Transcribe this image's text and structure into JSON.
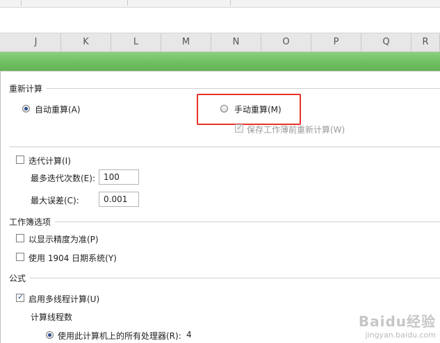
{
  "column_headers": [
    "J",
    "K",
    "L",
    "M",
    "N",
    "O",
    "P",
    "Q",
    "R"
  ],
  "recalc": {
    "title": "重新计算",
    "automatic_label": "自动重算(A)",
    "manual_label": "手动重算(M)",
    "save_before_recalc_label": "保存工作薄前重新计算(W)",
    "automatic_checked": true,
    "manual_checked": false
  },
  "iteration": {
    "enable_label": "迭代计算(I)",
    "max_iterations_label": "最多迭代次数(E):",
    "max_iterations_value": "100",
    "max_change_label": "最大误差(C):",
    "max_change_value": "0.001"
  },
  "workbook_options": {
    "title": "工作簿选项",
    "precision_label": "以显示精度为准(P)",
    "date1904_label": "使用 1904 日期系统(Y)"
  },
  "formulas": {
    "title": "公式",
    "multithread_label": "启用多线程计算(U)",
    "thread_count_label": "计算线程数",
    "use_all_processors_label": "使用此计算机上的所有处理器(R):",
    "processor_count": "4"
  },
  "watermark": {
    "logo_text": "Baidu经验",
    "url_text": "jingyan.baidu.com"
  },
  "colors": {
    "highlight": "#e8322a",
    "green_bar": "#6fbf62"
  }
}
